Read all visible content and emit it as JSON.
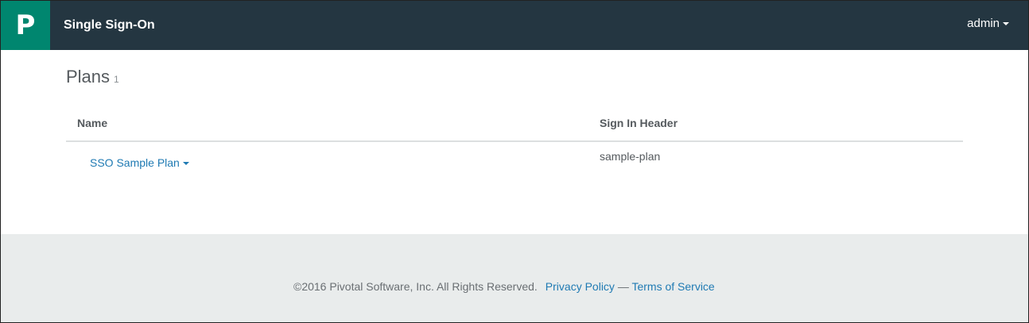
{
  "header": {
    "logo_letter": "P",
    "app_title": "Single Sign-On",
    "user_menu_label": "admin"
  },
  "page": {
    "title": "Plans",
    "count": "1"
  },
  "table": {
    "columns": [
      "Name",
      "Sign In Header"
    ],
    "rows": [
      {
        "name": "SSO Sample Plan",
        "sign_in_header": "sample-plan"
      }
    ]
  },
  "footer": {
    "copyright": "©2016 Pivotal Software, Inc. All Rights Reserved.",
    "privacy_link": "Privacy Policy",
    "separator": " — ",
    "terms_link": "Terms of Service"
  },
  "colors": {
    "navbar_bg": "#243641",
    "logo_bg": "#00866f",
    "link": "#1f7ab3",
    "footer_bg": "#e9ecec"
  }
}
